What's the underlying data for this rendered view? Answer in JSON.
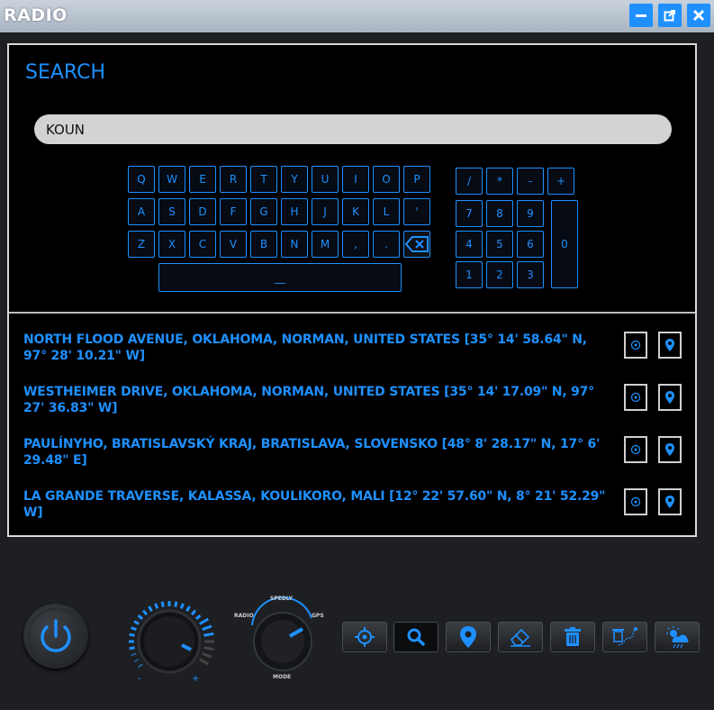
{
  "window": {
    "title": "RADIO"
  },
  "search": {
    "title": "SEARCH",
    "query": "KOUN"
  },
  "keyboard": {
    "row1": [
      "Q",
      "W",
      "E",
      "R",
      "T",
      "Y",
      "U",
      "I",
      "O",
      "P"
    ],
    "row2": [
      "A",
      "S",
      "D",
      "F",
      "G",
      "H",
      "J",
      "K",
      "L",
      "'"
    ],
    "row3": [
      "Z",
      "X",
      "C",
      "V",
      "B",
      "N",
      "M",
      ",",
      "."
    ],
    "space": "__",
    "numpad_top": [
      "/",
      "*",
      "-",
      "+"
    ],
    "numpad_rows": [
      [
        "7",
        "8",
        "9"
      ],
      [
        "4",
        "5",
        "6"
      ],
      [
        "1",
        "2",
        "3"
      ]
    ],
    "zero": "0"
  },
  "results": [
    {
      "text": "NORTH FLOOD AVENUE, OKLAHOMA, NORMAN, UNITED STATES [35° 14' 58.64\" N, 97° 28' 10.21\" W]"
    },
    {
      "text": "WESTHEIMER DRIVE, OKLAHOMA, NORMAN, UNITED STATES [35° 14' 17.09\" N, 97° 27' 36.83\" W]"
    },
    {
      "text": "PAULÍNYHO, BRATISLAVSKÝ KRAJ, BRATISLAVA, SLOVENSKO [48° 8' 28.17\" N, 17° 6' 29.48\" E]"
    },
    {
      "text": "LA GRANDE TRAVERSE, KALASSA, KOULIKORO, MALI [12° 22' 57.60\" N, 8° 21' 52.29\" W]"
    }
  ],
  "controls": {
    "volume_minus": "-",
    "volume_plus": "+",
    "mode_labels": {
      "left": "RADIO",
      "top": "SPEDLY",
      "right": "GPS",
      "bottom": "MODE"
    }
  },
  "colors": {
    "accent": "#1e90ff",
    "background": "#000000",
    "chrome": "#1d1f22"
  }
}
